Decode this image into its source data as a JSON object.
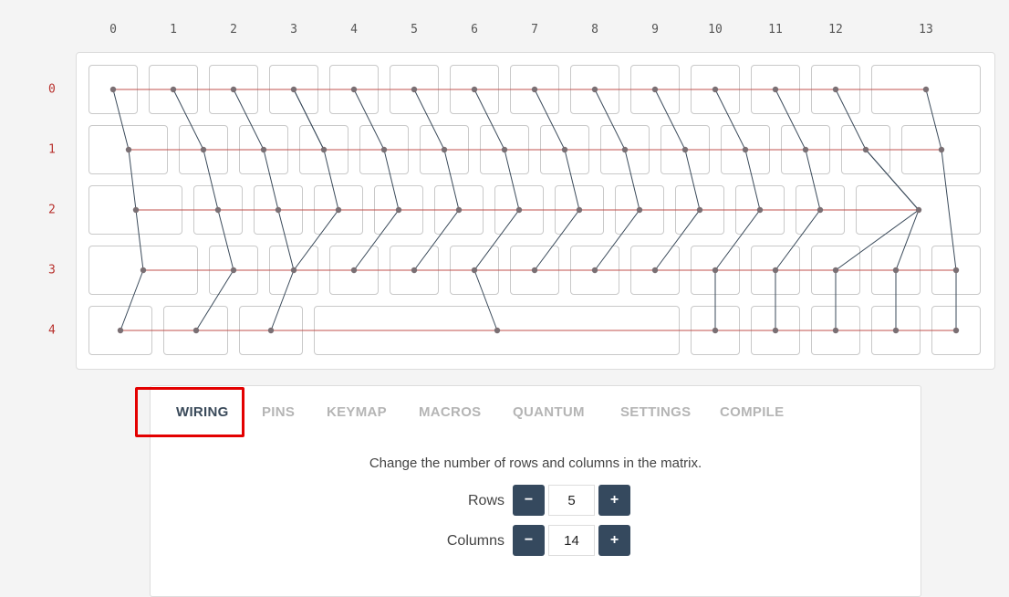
{
  "matrix": {
    "columns": [
      "0",
      "1",
      "2",
      "3",
      "4",
      "5",
      "6",
      "7",
      "8",
      "9",
      "10",
      "11",
      "12",
      "13"
    ],
    "rows": [
      "0",
      "1",
      "2",
      "3",
      "4"
    ]
  },
  "tabs": [
    {
      "label": "WIRING",
      "active": true
    },
    {
      "label": "PINS",
      "active": false
    },
    {
      "label": "KEYMAP",
      "active": false
    },
    {
      "label": "MACROS",
      "active": false
    },
    {
      "label": "QUANTUM",
      "active": false
    },
    {
      "label": "SETTINGS",
      "active": false
    },
    {
      "label": "COMPILE",
      "active": false
    }
  ],
  "wiring": {
    "description": "Change the number of rows and columns in the matrix.",
    "rows_label": "Rows",
    "rows_value": "5",
    "columns_label": "Columns",
    "columns_value": "14",
    "minus_icon": "minus-icon",
    "plus_icon": "plus-icon"
  },
  "colors": {
    "row_wire": "#c0504d",
    "col_wire": "#3a4a5a",
    "node": "#7a6f73",
    "active_tab": "#3a4a5a",
    "highlight": "#e30000",
    "button": "#35495e"
  }
}
